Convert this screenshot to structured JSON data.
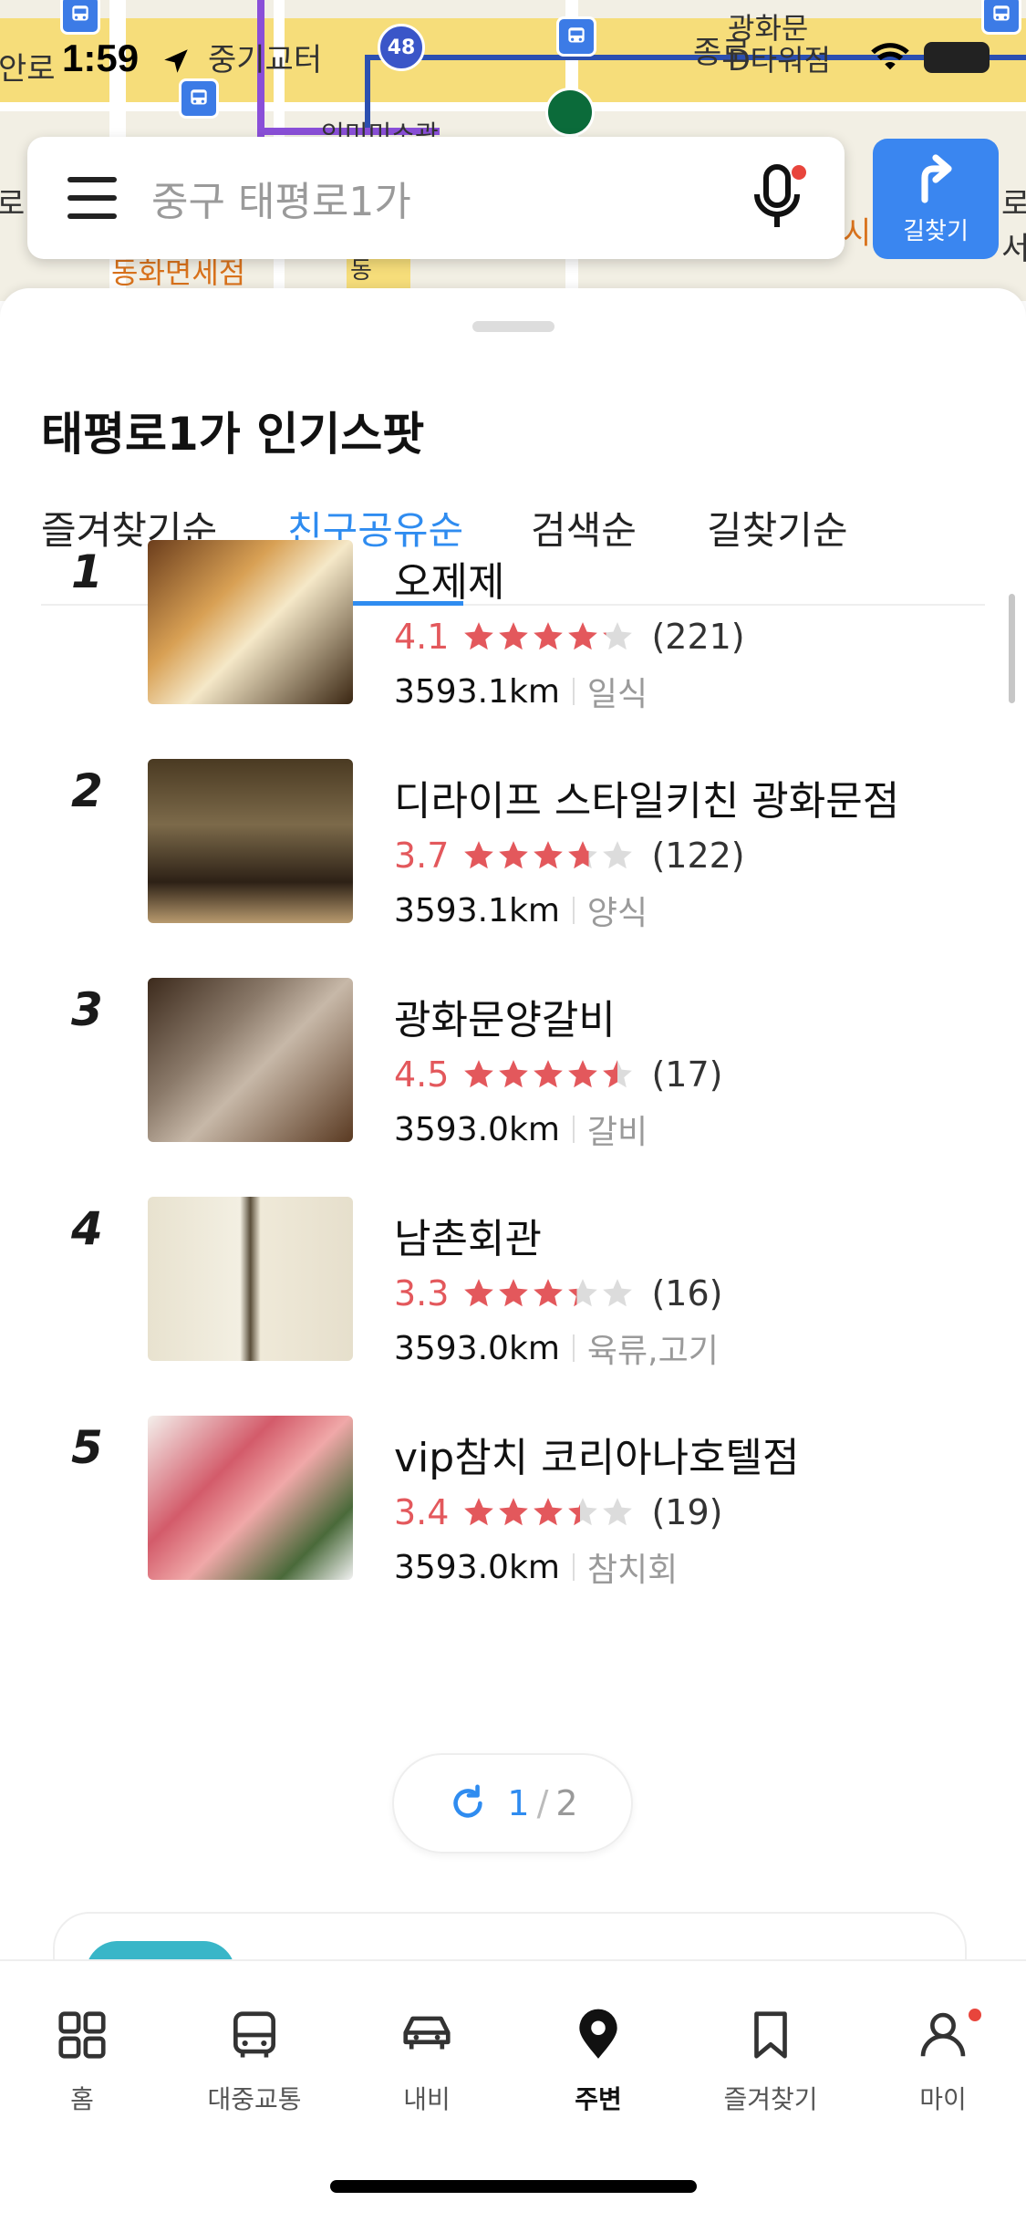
{
  "status_bar": {
    "time": "1:59"
  },
  "map": {
    "route_number": "48",
    "labels": {
      "left_road": "안로",
      "school": "중기교터",
      "theater": "인미미소관",
      "duty_free": "동화면세점",
      "east_road": "동",
      "jongro": "종로",
      "dtower": "광화문\nD타워점",
      "right_edge": "로서",
      "place_right": "시",
      "left_edge": "로"
    }
  },
  "search": {
    "placeholder": "중구 태평로1가",
    "route_button_label": "길찾기"
  },
  "sheet": {
    "title": "태평로1가 인기스팟",
    "tabs": [
      {
        "label": "즐겨찾기순",
        "active": false
      },
      {
        "label": "친구공유순",
        "active": true
      },
      {
        "label": "검색순",
        "active": false
      },
      {
        "label": "길찾기순",
        "active": false
      }
    ],
    "places": [
      {
        "rank": "1",
        "name": "오제제",
        "rating": "4.1",
        "rating_value": 4.1,
        "count": "(221)",
        "distance": "3593.1km",
        "category": "일식"
      },
      {
        "rank": "2",
        "name": "디라이프 스타일키친 광화문점",
        "rating": "3.7",
        "rating_value": 3.7,
        "count": "(122)",
        "distance": "3593.1km",
        "category": "양식"
      },
      {
        "rank": "3",
        "name": "광화문양갈비",
        "rating": "4.5",
        "rating_value": 4.5,
        "count": "(17)",
        "distance": "3593.0km",
        "category": "갈비"
      },
      {
        "rank": "4",
        "name": "남촌회관",
        "rating": "3.3",
        "rating_value": 3.3,
        "count": "(16)",
        "distance": "3593.0km",
        "category": "육류,고기"
      },
      {
        "rank": "5",
        "name": "vip참치 코리아나호텔점",
        "rating": "3.4",
        "rating_value": 3.4,
        "count": "(19)",
        "distance": "3593.0km",
        "category": "참치회"
      }
    ],
    "pager": {
      "current": "1",
      "separator": "/",
      "total": "2"
    }
  },
  "bottom_nav": [
    {
      "label": "홈",
      "icon": "grid-icon",
      "active": false
    },
    {
      "label": "대중교통",
      "icon": "bus-icon",
      "active": false
    },
    {
      "label": "내비",
      "icon": "car-icon",
      "active": false
    },
    {
      "label": "주변",
      "icon": "location-pin-icon",
      "active": true
    },
    {
      "label": "즐겨찾기",
      "icon": "bookmark-icon",
      "active": false
    },
    {
      "label": "마이",
      "icon": "person-icon",
      "active": false
    }
  ],
  "colors": {
    "accent": "#2f8cf0",
    "star": "#e3585c",
    "route_button": "#3a86f0"
  }
}
